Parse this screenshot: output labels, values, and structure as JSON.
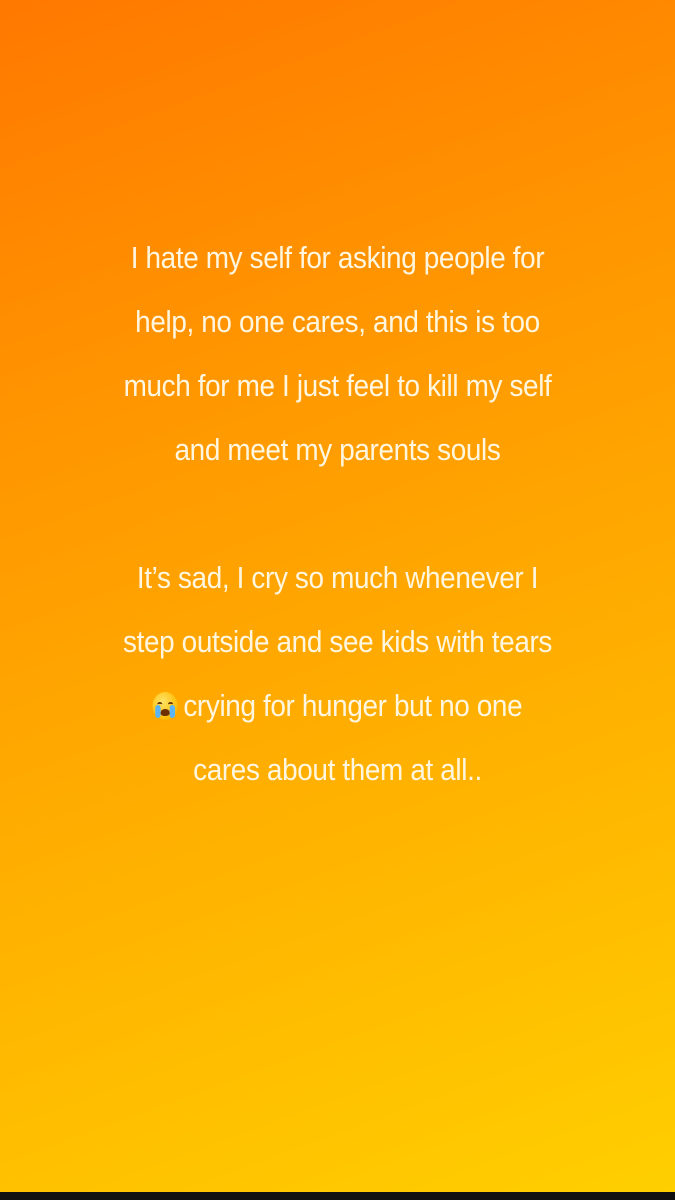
{
  "story": {
    "paragraph_1": [
      "I hate my self for asking people for",
      "help, no one cares, and this is too",
      "much for me I just feel to kill my self",
      "and meet my parents souls"
    ],
    "paragraph_2": [
      "It’s sad, I cry so much whenever I",
      "step outside and see kids with tears",
      "crying for hunger but no one",
      "cares about them at all.."
    ],
    "emoji": "loudly-crying-face-icon"
  },
  "colors": {
    "gradient_start": "#ff7800",
    "gradient_end": "#ffcf00",
    "text": "#fff6e0"
  }
}
